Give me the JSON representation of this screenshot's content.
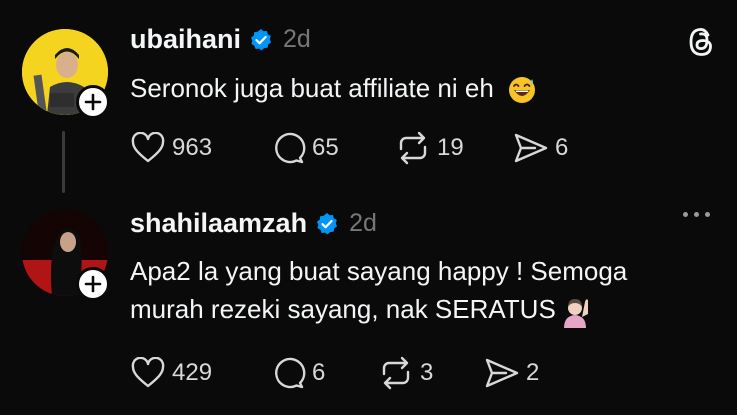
{
  "posts": [
    {
      "username": "ubaihani",
      "time": "2d",
      "text": "Seronok juga buat affiliate ni eh",
      "emoji": "sweat-smile-emoji",
      "likes": "963",
      "replies": "65",
      "reposts": "19",
      "shares": "6"
    },
    {
      "username": "shahilaamzah",
      "time": "2d",
      "text_line1": "Apa2 la yang buat sayang happy ! Semoga",
      "text_line2": "murah rezeki sayang, nak SERATUS",
      "emoji": "raising-hand-emoji",
      "likes": "429",
      "replies": "6",
      "reposts": "3",
      "shares": "2"
    }
  ],
  "colors": {
    "background": "#0a0a0a",
    "text": "#f3f5f7",
    "muted": "#777777",
    "verified": "#0095f6"
  }
}
